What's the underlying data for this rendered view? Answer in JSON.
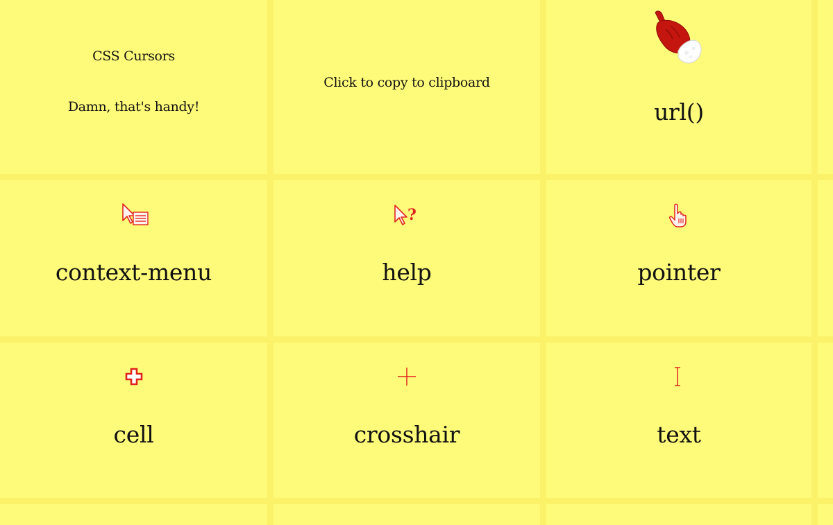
{
  "intro": {
    "title": "CSS Cursors",
    "subtitle": "Damn, that's handy!"
  },
  "copy_hint": "Click to copy to clipboard",
  "cursors": [
    {
      "label": "url()",
      "icon": "santa-hand-pointer-icon"
    },
    {
      "label": "context-menu",
      "icon": "context-menu-cursor-icon"
    },
    {
      "label": "help",
      "icon": "help-cursor-icon"
    },
    {
      "label": "pointer",
      "icon": "pointer-hand-cursor-icon"
    },
    {
      "label": "cell",
      "icon": "cell-cursor-icon"
    },
    {
      "label": "crosshair",
      "icon": "crosshair-cursor-icon"
    },
    {
      "label": "text",
      "icon": "text-ibeam-cursor-icon"
    }
  ],
  "colors": {
    "background": "#fbf26a",
    "tile": "#fffb7a",
    "icon_red": "#e0261c"
  }
}
